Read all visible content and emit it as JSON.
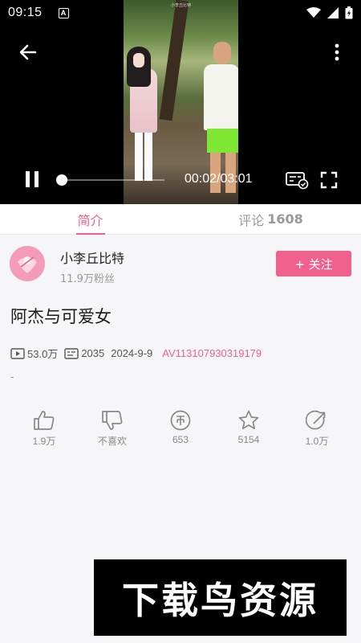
{
  "status_bar": {
    "time": "09:15",
    "notification_letter": "A"
  },
  "video": {
    "caption": "小李丘比特",
    "current_time": "00:02/03:01",
    "progress": 0.011
  },
  "tabs": {
    "intro_label": "简介",
    "comments_label": "评论",
    "comments_count": "1608"
  },
  "uploader": {
    "name": "小李丘比特",
    "fans": "11.9万粉丝",
    "follow_label": "+ 关注"
  },
  "video_info": {
    "title": "阿杰与可爱女",
    "views": "53.0万",
    "danmaku": "2035",
    "date": "2024-9-9",
    "av_id": "AV113107930319179",
    "description": "-"
  },
  "actions": {
    "like": "1.9万",
    "dislike": "不喜欢",
    "coin": "653",
    "favorite": "5154",
    "share": "1.0万"
  },
  "watermark": {
    "text": "下载鸟资源"
  },
  "colors": {
    "accent": "#f0608f",
    "background": "#f6f6f8"
  },
  "icons": [
    "back-arrow-icon",
    "more-vertical-icon",
    "pause-icon",
    "danmaku-settings-icon",
    "fullscreen-icon",
    "play-count-icon",
    "danmaku-count-icon",
    "like-icon",
    "dislike-icon",
    "coin-icon",
    "favorite-star-icon",
    "share-icon",
    "wifi-icon",
    "signal-icon",
    "battery-icon"
  ]
}
